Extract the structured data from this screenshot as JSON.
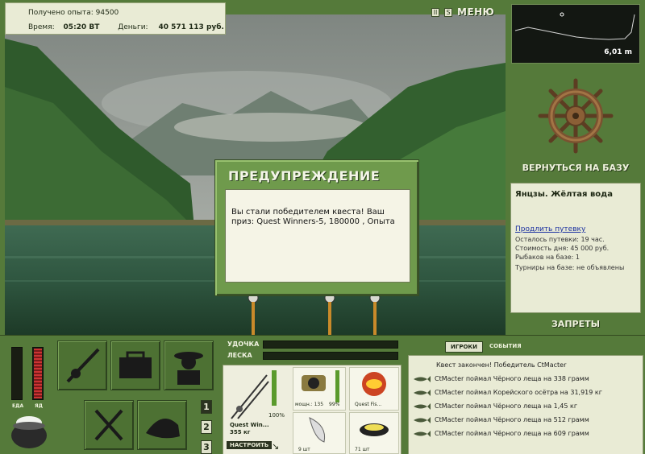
{
  "info": {
    "exp_label": "Получено опыта:",
    "exp_value": "94500",
    "time_label": "Время:",
    "time_value": "05:20 ВТ",
    "money_label": "Деньги:",
    "money_value": "40 571 113 руб."
  },
  "top_buttons": {
    "pause": "II",
    "sound": "S",
    "menu": "МЕНЮ"
  },
  "depth": {
    "value": "6,01 m"
  },
  "right_panel": {
    "return_label": "ВЕРНУТЬСЯ НА БАЗУ",
    "location_title": "Янцзы. Жёлтая вода",
    "extend_link": "Продлить путевку",
    "remaining": "Осталось путевки: 19 час.",
    "cost": "Стоимость дня: 45 000 руб.",
    "fishers": "Рыбаков на базе: 1",
    "tournaments": "Турниры на базе: не объявлены",
    "bans_label": "ЗАПРЕТЫ"
  },
  "dialog": {
    "title": "ПРЕДУПРЕЖДЕНИЕ",
    "message": "Вы стали победителем квеста! Ваш приз: Quest Winners-5, 180000 , Опыта"
  },
  "gauges": {
    "food_label": "ЕДА",
    "poison_label": "ЯД"
  },
  "rod_numbers": [
    "1",
    "2",
    "3"
  ],
  "tackle": {
    "rod_label": "УДОЧКА",
    "line_label": "ЛЕСКА",
    "rod_name": "Quest Win...",
    "rod_weight": "355 кг",
    "rod_percent": "100%",
    "setup_button": "НАСТРОИТЬ",
    "reel_power": "мощн.: 135",
    "reel_percent": "99%",
    "bait_name": "Quest Fis...",
    "hook_count": "9 шт",
    "lure_count": "71 шт"
  },
  "feed": {
    "tab_players": "ИГРОКИ",
    "tab_events": "СОБЫТИЯ",
    "header": "Квест закончен! Победитель CtMacter",
    "rows": [
      "CtMacter поймал Чёрного леща на 338 грамм",
      "CtMacter поймал Корейского осётра на 31,919 кг",
      "CtMacter поймал Чёрного леща на 1,45 кг",
      "CtMacter поймал Чёрного леща на 512 грамм",
      "CtMacter поймал Чёрного леща на 609 грамм"
    ]
  }
}
